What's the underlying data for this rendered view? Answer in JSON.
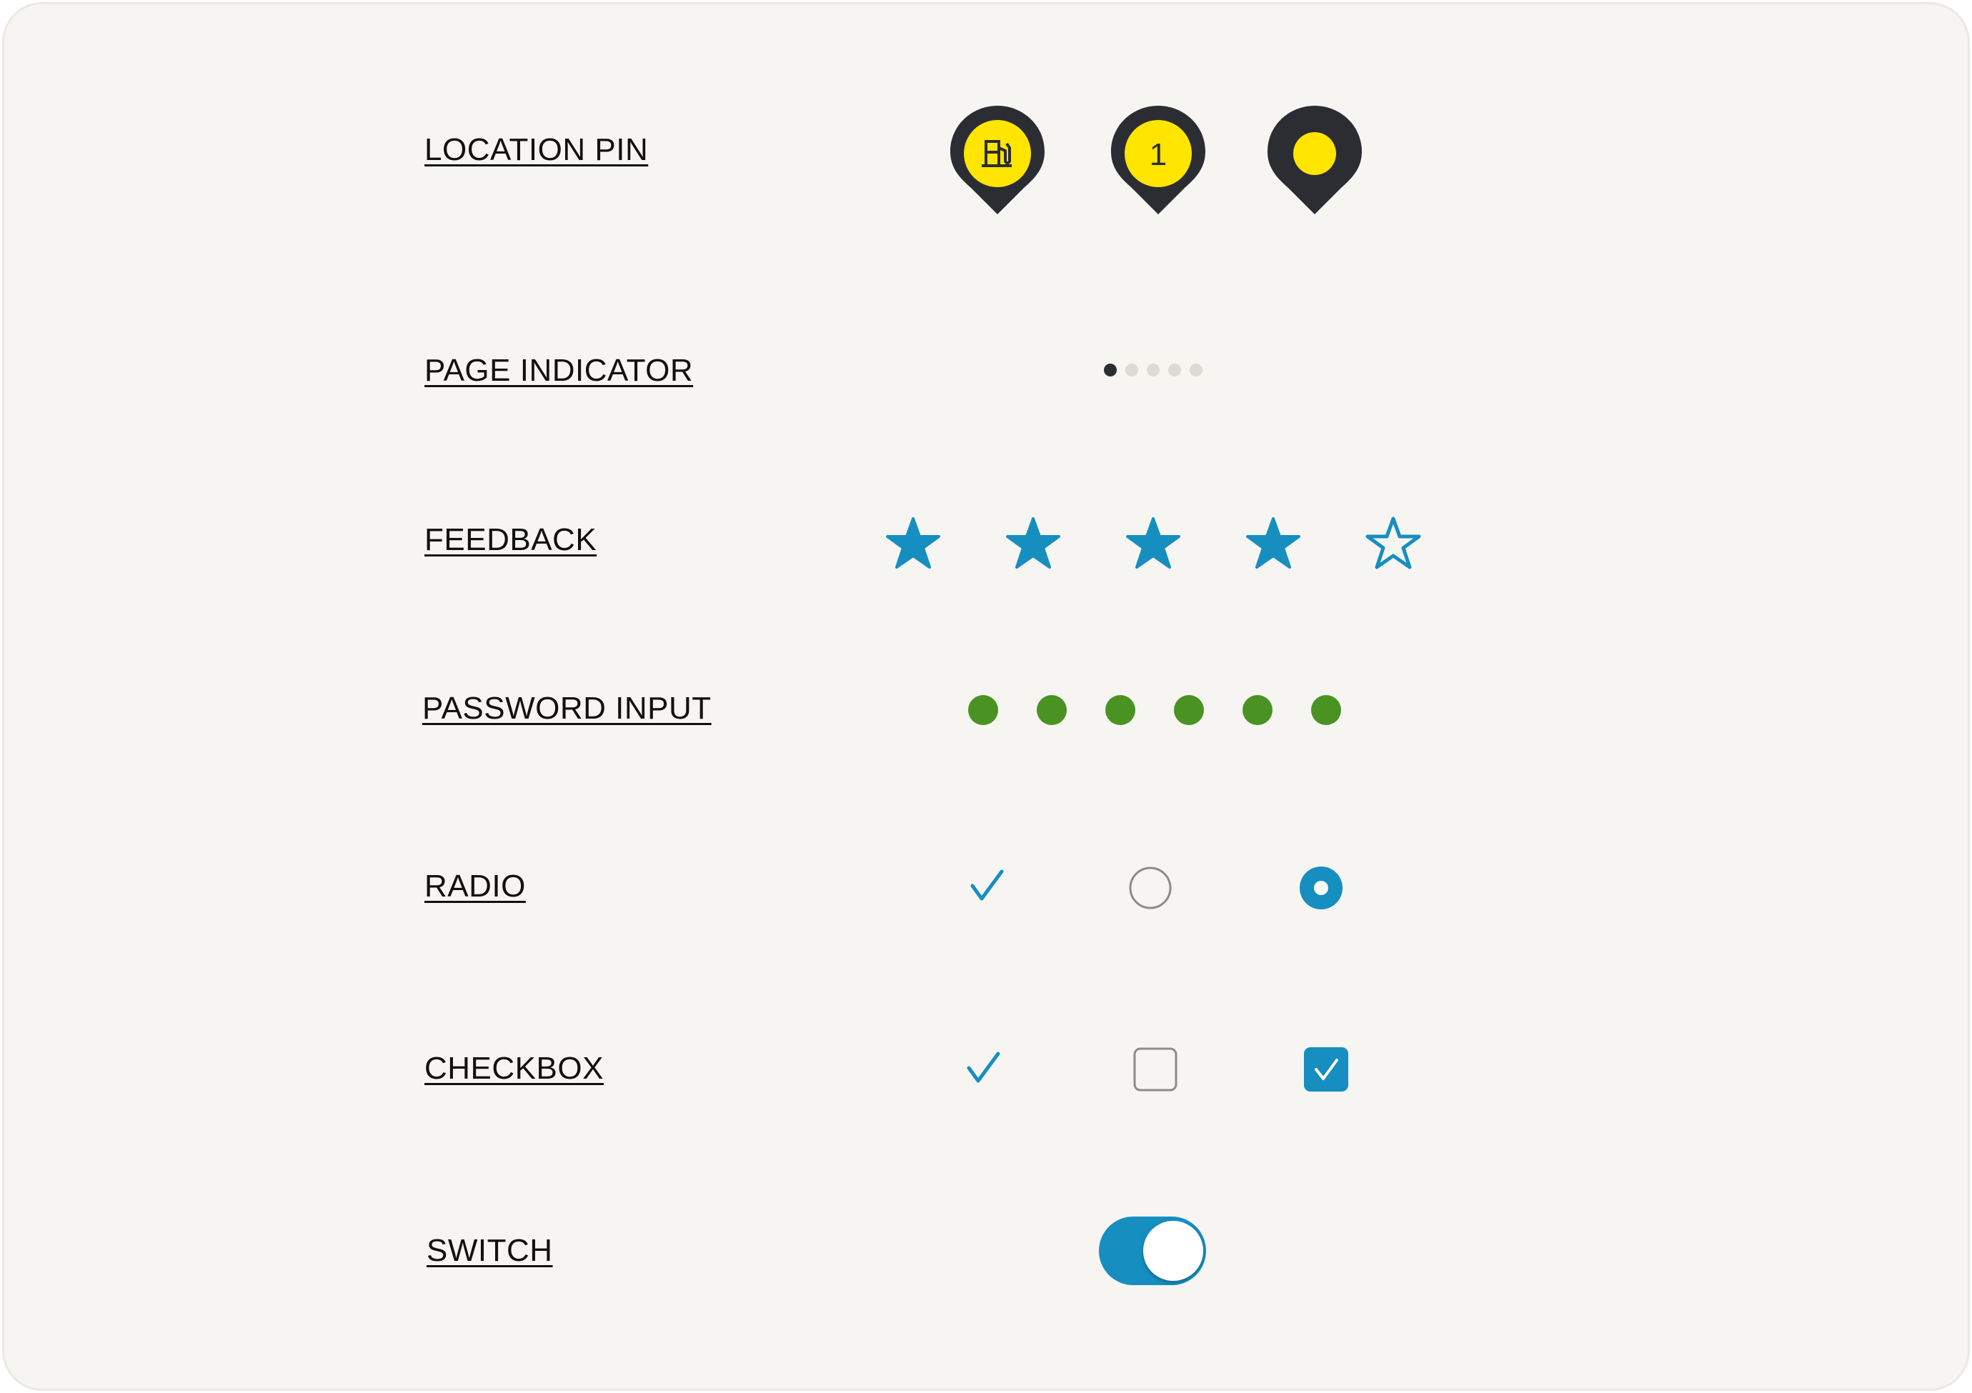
{
  "labels": {
    "location_pin": "LOCATION PIN",
    "page_indicator": "PAGE INDICATOR",
    "feedback": "FEEDBACK",
    "password_input": "PASSWORD INPUT",
    "radio": "RADIO",
    "checkbox": "CHECKBOX",
    "switch": "SWITCH"
  },
  "location_pins": [
    {
      "icon": "fuel-station-icon"
    },
    {
      "text": "1"
    },
    {
      "icon": "dot-icon"
    }
  ],
  "page_indicator": {
    "total": 5,
    "active": 1
  },
  "feedback": {
    "rating": 4,
    "max": 5
  },
  "password_input": {
    "filled_count": 6
  },
  "radio_states": [
    "check",
    "unselected",
    "selected"
  ],
  "checkbox_states": [
    "check",
    "unchecked",
    "checked"
  ],
  "switch": {
    "state": "on"
  },
  "colors": {
    "pin_dark": "#2b2d33",
    "pin_yellow": "#ffe500",
    "accent_blue": "#168ec0",
    "password_green": "#4a9221",
    "indicator_inactive": "#dcdbd3",
    "outline_gray": "#8b8b8b",
    "card_bg": "#f6f5f2"
  }
}
